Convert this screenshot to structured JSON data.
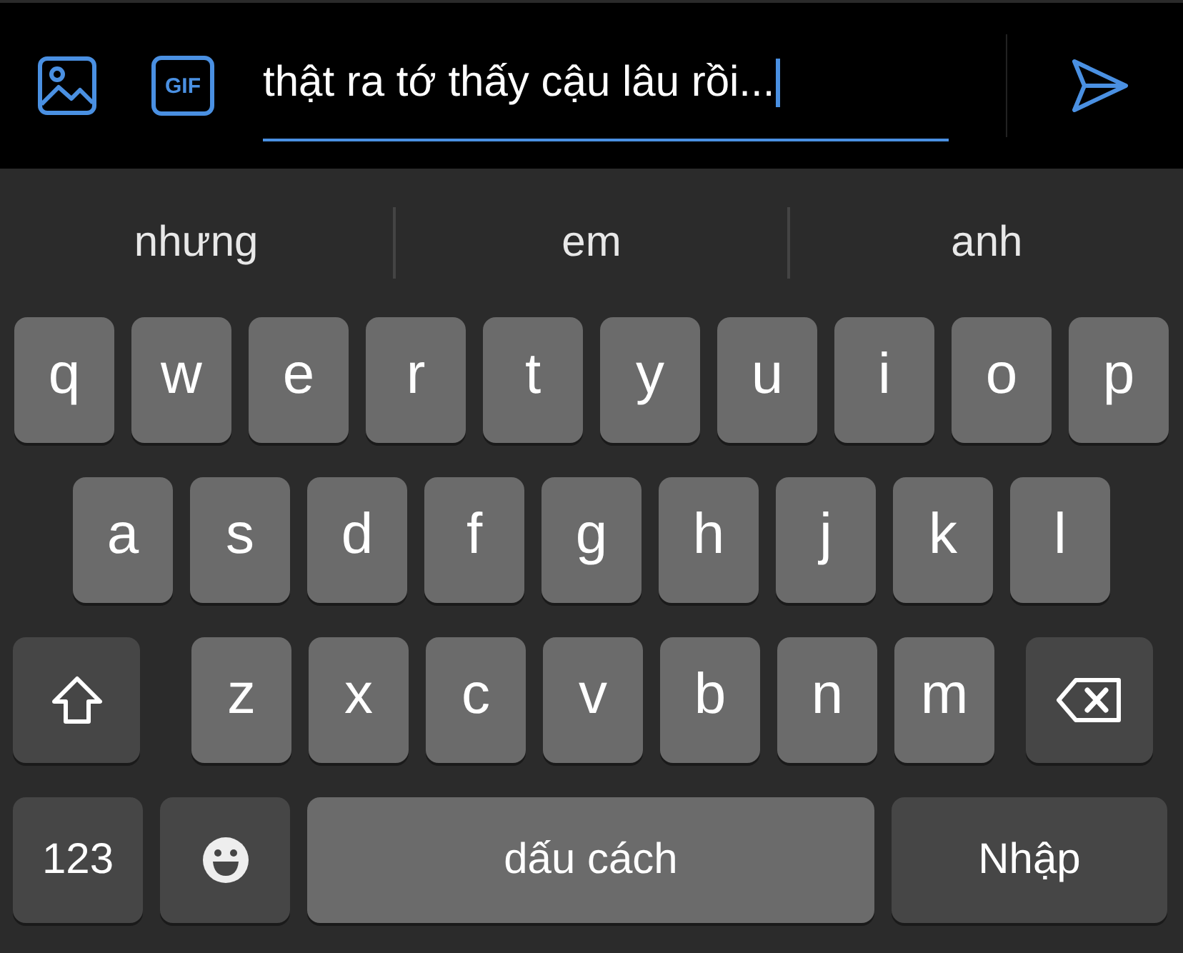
{
  "composer": {
    "gif_label": "GIF",
    "message": "thật ra tớ thấy cậu lâu rồi..."
  },
  "suggestions": [
    "nhưng",
    "em",
    "anh"
  ],
  "keyboard": {
    "rows": [
      {
        "keys": [
          {
            "kind": "letter",
            "label": "q"
          },
          {
            "kind": "letter",
            "label": "w"
          },
          {
            "kind": "letter",
            "label": "e"
          },
          {
            "kind": "letter",
            "label": "r"
          },
          {
            "kind": "letter",
            "label": "t"
          },
          {
            "kind": "letter",
            "label": "y"
          },
          {
            "kind": "letter",
            "label": "u"
          },
          {
            "kind": "letter",
            "label": "i"
          },
          {
            "kind": "letter",
            "label": "o"
          },
          {
            "kind": "letter",
            "label": "p"
          }
        ]
      },
      {
        "keys": [
          {
            "kind": "letter",
            "label": "a"
          },
          {
            "kind": "letter",
            "label": "s"
          },
          {
            "kind": "letter",
            "label": "d"
          },
          {
            "kind": "letter",
            "label": "f"
          },
          {
            "kind": "letter",
            "label": "g"
          },
          {
            "kind": "letter",
            "label": "h"
          },
          {
            "kind": "letter",
            "label": "j"
          },
          {
            "kind": "letter",
            "label": "k"
          },
          {
            "kind": "letter",
            "label": "l"
          }
        ]
      },
      {
        "keys": [
          {
            "kind": "shift"
          },
          {
            "kind": "letter",
            "label": "z"
          },
          {
            "kind": "letter",
            "label": "x"
          },
          {
            "kind": "letter",
            "label": "c"
          },
          {
            "kind": "letter",
            "label": "v"
          },
          {
            "kind": "letter",
            "label": "b"
          },
          {
            "kind": "letter",
            "label": "n"
          },
          {
            "kind": "letter",
            "label": "m"
          },
          {
            "kind": "backspace"
          }
        ]
      },
      {
        "keys": [
          {
            "kind": "numbers",
            "label": "123"
          },
          {
            "kind": "emoji"
          },
          {
            "kind": "space",
            "label": "dấu cách"
          },
          {
            "kind": "return",
            "label": "Nhập"
          }
        ]
      }
    ]
  }
}
